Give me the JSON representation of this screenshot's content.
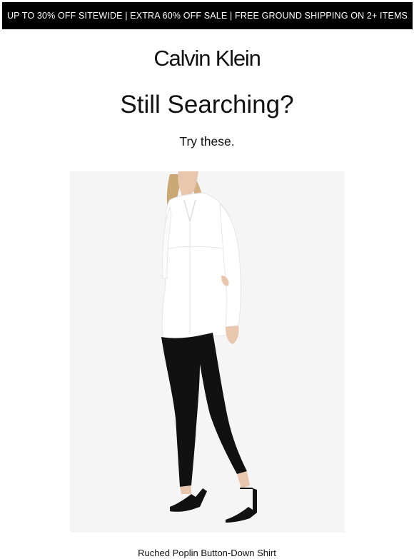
{
  "promo_banner": {
    "text": "UP TO 30% OFF SITEWIDE | EXTRA 60% OFF SALE | FREE GROUND SHIPPING ON 2+ ITEMS"
  },
  "brand": {
    "logo_text": "Calvin Klein"
  },
  "hero": {
    "headline": "Still Searching?",
    "subhead": "Try these."
  },
  "product": {
    "image_icon": "product-photo-woman-white-shirt-black-pants",
    "name": "Ruched Poplin Button-Down Shirt"
  },
  "colors": {
    "banner_bg": "#000000",
    "banner_text": "#ffffff",
    "image_bg": "#f5f5f6",
    "text": "#111111"
  }
}
